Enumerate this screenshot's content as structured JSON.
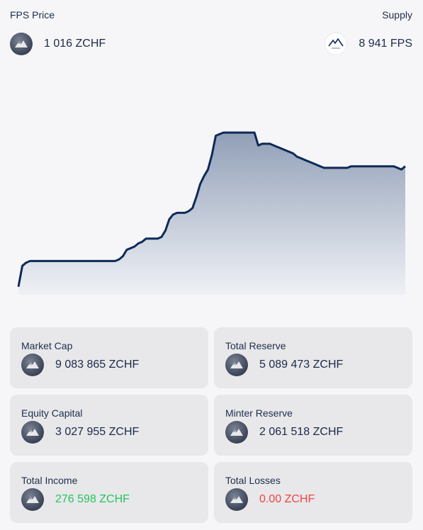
{
  "header": {
    "price_label": "FPS Price",
    "supply_label": "Supply",
    "price_value": "1 016 ZCHF",
    "supply_value": "8 941 FPS"
  },
  "icons": {
    "zchf": "mountain-coin-icon",
    "fps": "mountain-logo-icon"
  },
  "colors": {
    "line": "#0d2a5a",
    "positive": "#22c55e",
    "negative": "#ef4444",
    "card_bg": "#e8e8ea"
  },
  "chart_data": {
    "type": "area",
    "title": "",
    "xlabel": "",
    "ylabel": "",
    "grid": false,
    "x": [
      0,
      1,
      2,
      3,
      4,
      5,
      6,
      7,
      8,
      9,
      10,
      11,
      12,
      13,
      14,
      15,
      16,
      17,
      18,
      19,
      20,
      21,
      22,
      23,
      24,
      25,
      26,
      27,
      28,
      29,
      30,
      31,
      32,
      33,
      34,
      35,
      36,
      37,
      38,
      39,
      40,
      41,
      42,
      43,
      44,
      45,
      46,
      47,
      48,
      49,
      50,
      51,
      52,
      53,
      54,
      55,
      56,
      57,
      58,
      59,
      60,
      61,
      62,
      63,
      64,
      65,
      66,
      67,
      68,
      69,
      70,
      71,
      72,
      73,
      74,
      75,
      76,
      77,
      78,
      79,
      80,
      81,
      82,
      83,
      84,
      85,
      86,
      87,
      88,
      89,
      90,
      91,
      92,
      93,
      94,
      95,
      96,
      97,
      98,
      99,
      100
    ],
    "values": [
      0.05,
      0.18,
      0.2,
      0.21,
      0.21,
      0.21,
      0.21,
      0.21,
      0.21,
      0.21,
      0.21,
      0.21,
      0.21,
      0.21,
      0.21,
      0.21,
      0.21,
      0.21,
      0.21,
      0.21,
      0.21,
      0.21,
      0.21,
      0.21,
      0.21,
      0.21,
      0.22,
      0.24,
      0.28,
      0.29,
      0.3,
      0.32,
      0.33,
      0.35,
      0.35,
      0.35,
      0.35,
      0.36,
      0.4,
      0.47,
      0.5,
      0.51,
      0.51,
      0.51,
      0.52,
      0.54,
      0.61,
      0.69,
      0.74,
      0.78,
      0.87,
      0.99,
      1.0,
      1.01,
      1.01,
      1.01,
      1.01,
      1.01,
      1.01,
      1.01,
      1.01,
      1.01,
      0.93,
      0.94,
      0.94,
      0.94,
      0.93,
      0.92,
      0.91,
      0.9,
      0.89,
      0.88,
      0.86,
      0.85,
      0.84,
      0.83,
      0.82,
      0.81,
      0.8,
      0.79,
      0.79,
      0.79,
      0.79,
      0.79,
      0.79,
      0.79,
      0.8,
      0.8,
      0.8,
      0.8,
      0.8,
      0.8,
      0.8,
      0.8,
      0.8,
      0.8,
      0.8,
      0.8,
      0.79,
      0.78,
      0.8
    ],
    "ylim": [
      0,
      1.05
    ]
  },
  "cards": [
    {
      "label": "Market Cap",
      "value": "9 083 865 ZCHF",
      "tone": "neutral"
    },
    {
      "label": "Total Reserve",
      "value": "5 089 473 ZCHF",
      "tone": "neutral"
    },
    {
      "label": "Equity Capital",
      "value": "3 027 955 ZCHF",
      "tone": "neutral"
    },
    {
      "label": "Minter Reserve",
      "value": "2 061 518 ZCHF",
      "tone": "neutral"
    },
    {
      "label": "Total Income",
      "value": "276 598 ZCHF",
      "tone": "positive"
    },
    {
      "label": "Total Losses",
      "value": "0.00 ZCHF",
      "tone": "negative"
    }
  ]
}
